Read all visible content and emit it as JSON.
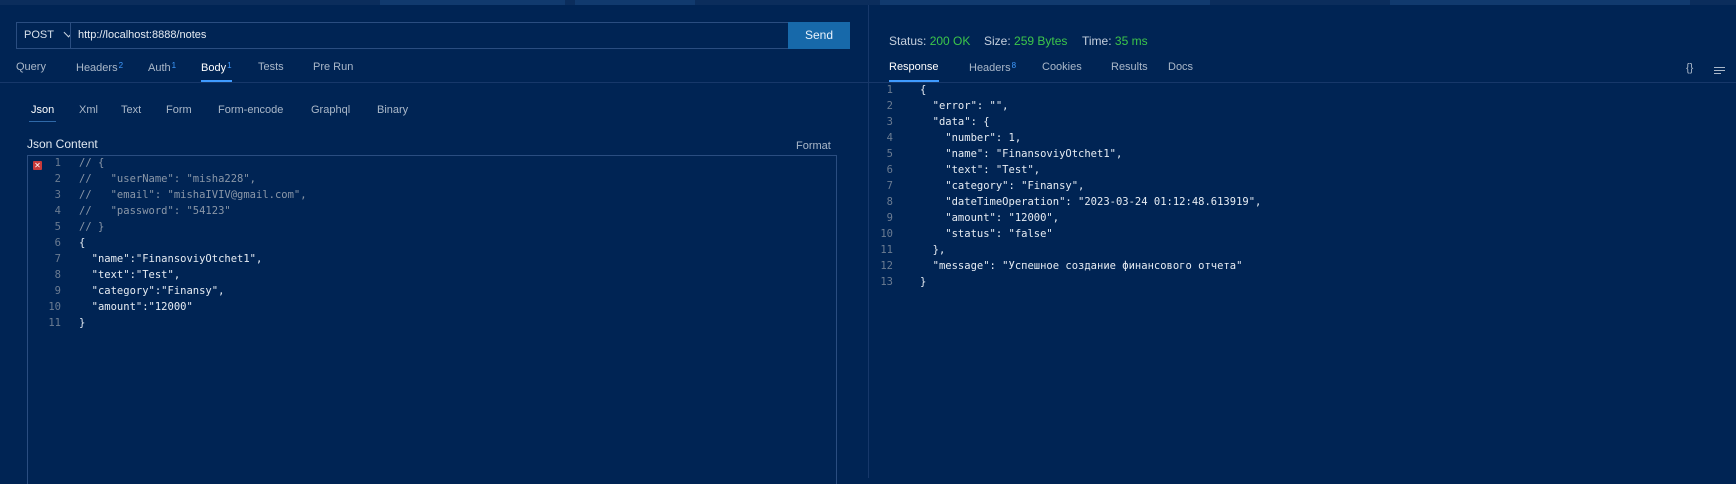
{
  "request": {
    "method": "POST",
    "url": "http://localhost:8888/notes",
    "send_label": "Send",
    "tabs": [
      {
        "label": "Query",
        "badge": ""
      },
      {
        "label": "Headers",
        "badge": "2"
      },
      {
        "label": "Auth",
        "badge": "1"
      },
      {
        "label": "Body",
        "badge": "1"
      },
      {
        "label": "Tests",
        "badge": ""
      },
      {
        "label": "Pre Run",
        "badge": ""
      }
    ],
    "body_types": [
      "Json",
      "Xml",
      "Text",
      "Form",
      "Form-encode",
      "Graphql",
      "Binary"
    ],
    "json_content_label": "Json Content",
    "format_label": "Format",
    "code_lines": [
      "// {",
      "//   \"userName\": \"misha228\",",
      "//   \"email\": \"mishaIVIV@gmail.com\",",
      "//   \"password\": \"54123\"",
      "// }",
      "{",
      "  \"name\":\"FinansoviyOtchet1\",",
      "  \"text\":\"Test\",",
      "  \"category\":\"Finansy\",",
      "  \"amount\":\"12000\"",
      "}"
    ],
    "line_numbers": [
      "1",
      "2",
      "3",
      "4",
      "5",
      "6",
      "7",
      "8",
      "9",
      "10",
      "11"
    ]
  },
  "response": {
    "status_label": "Status:",
    "status_value": "200 OK",
    "size_label": "Size:",
    "size_value": "259 Bytes",
    "time_label": "Time:",
    "time_value": "35 ms",
    "tabs": [
      {
        "label": "Response",
        "badge": ""
      },
      {
        "label": "Headers",
        "badge": "8"
      },
      {
        "label": "Cookies",
        "badge": ""
      },
      {
        "label": "Results",
        "badge": ""
      },
      {
        "label": "Docs",
        "badge": ""
      }
    ],
    "code_lines": [
      "{",
      "  \"error\": \"\",",
      "  \"data\": {",
      "    \"number\": 1,",
      "    \"name\": \"FinansoviyOtchet1\",",
      "    \"text\": \"Test\",",
      "    \"category\": \"Finansy\",",
      "    \"dateTimeOperation\": \"2023-03-24 01:12:48.613919\",",
      "    \"amount\": \"12000\",",
      "    \"status\": \"false\"",
      "  },",
      "  \"message\": \"Успешное создание финансового отчета\"",
      "}"
    ],
    "line_numbers": [
      "1",
      "2",
      "3",
      "4",
      "5",
      "6",
      "7",
      "8",
      "9",
      "10",
      "11",
      "12",
      "13"
    ],
    "icons": {
      "braces": "{}",
      "menu": "menu-icon"
    }
  },
  "colors": {
    "background": "#002454",
    "accent": "#3f9bff",
    "send": "#1769aa",
    "ok": "#3cc64a"
  }
}
